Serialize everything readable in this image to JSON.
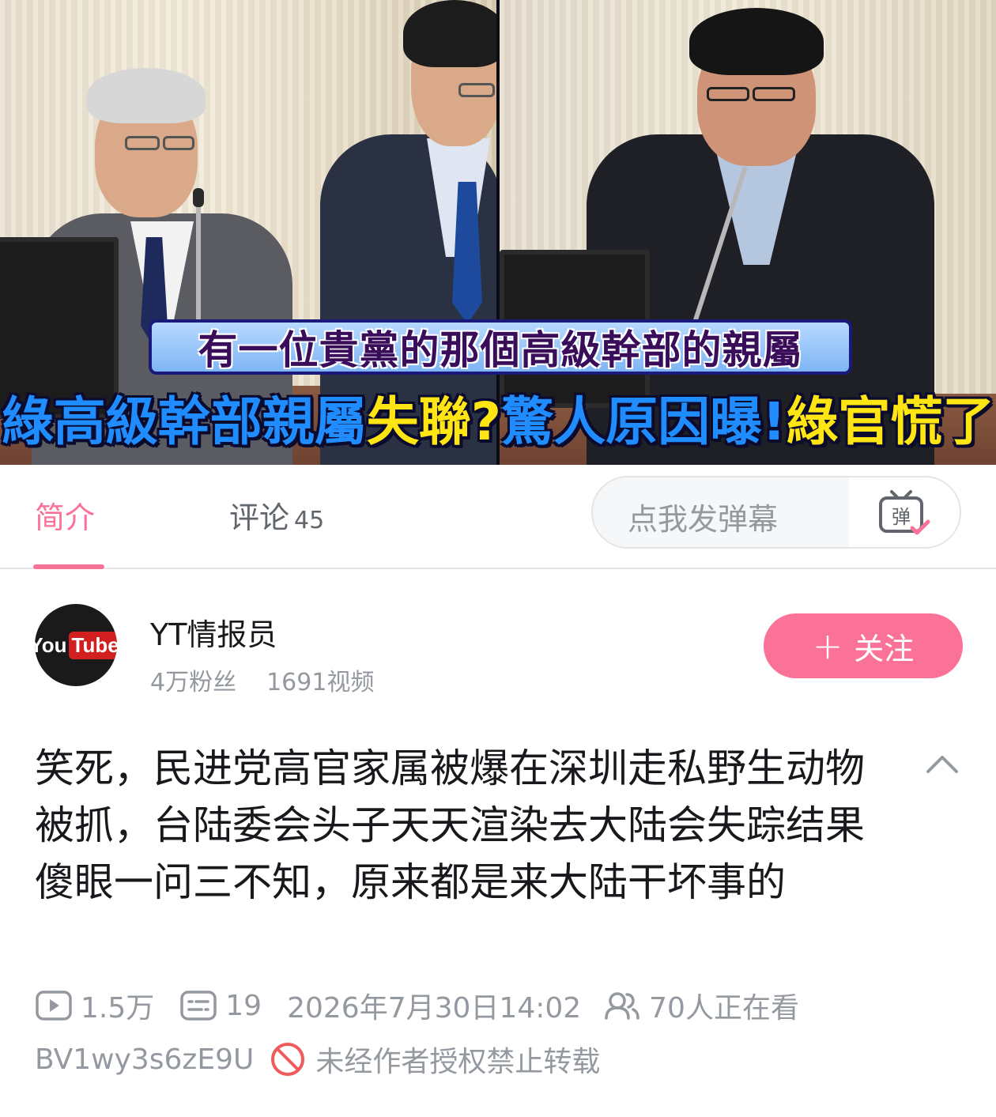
{
  "video": {
    "caption_top": "有一位貴黨的那個高級幹部的親屬",
    "caption_main_part1": "綠高級幹部親屬",
    "caption_main_part2": "失聯?",
    "caption_main_part3": "驚人原因曝!",
    "caption_main_part4": "綠官慌了"
  },
  "tabs": {
    "intro_label": "简介",
    "comments_label": "评论",
    "comments_count": "45",
    "danmaku_placeholder": "点我发弹幕",
    "danmaku_icon_text": "弹"
  },
  "uploader": {
    "avatar_text_you": "You",
    "avatar_text_tube": "Tube",
    "name": "YT情报员",
    "fans": "4万粉丝",
    "videos": "1691视频",
    "follow_plus": "+",
    "follow_label": "关注"
  },
  "video_info": {
    "title": "笑死，民进党高官家属被爆在深圳走私野生动物被抓，台陆委会头子天天渲染去大陆会失踪结果傻眼一问三不知，原来都是来大陆干坏事的",
    "views": "1.5万",
    "danmaku_count": "19",
    "publish_time": "2026年7月30日14:02",
    "watching_now": "70人正在看",
    "bvid": "BV1wy3s6zE9U",
    "copyright_notice": "未经作者授权禁止转载"
  },
  "colors": {
    "accent_pink": "#fb7299",
    "text_primary": "#18191c",
    "text_secondary": "#9499a0",
    "danger_red": "#f05a5a"
  },
  "icons": [
    "play-count-icon",
    "danmaku-count-icon",
    "watching-icon",
    "no-repost-icon",
    "danmaku-toggle-icon",
    "collapse-chevron-icon"
  ]
}
